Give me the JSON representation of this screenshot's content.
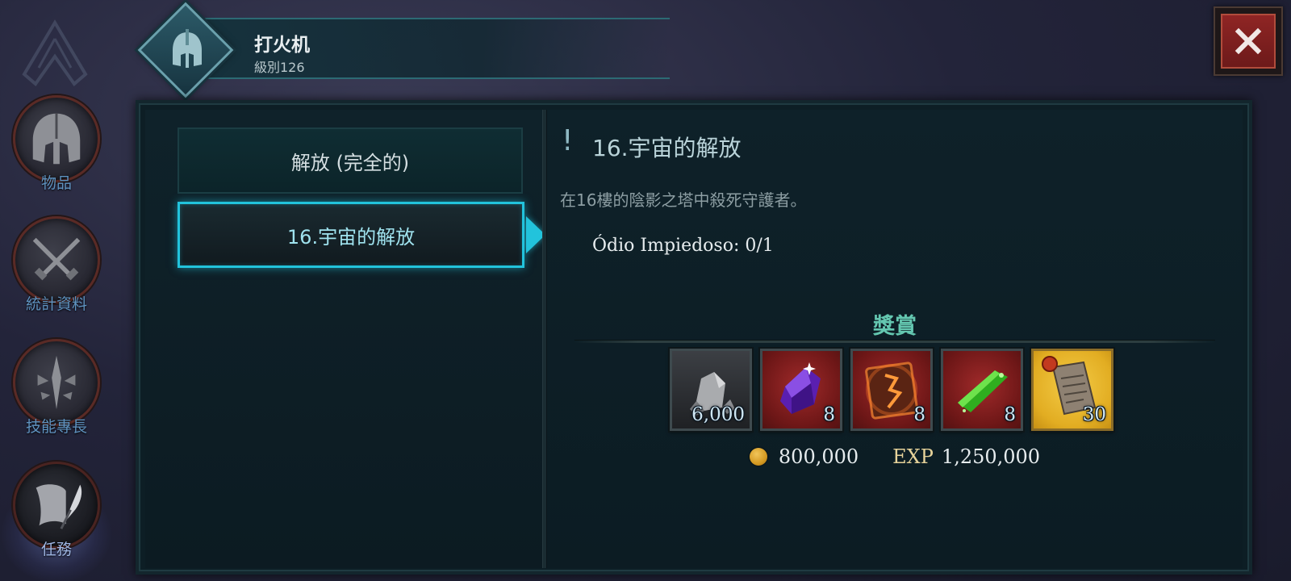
{
  "header": {
    "name": "打火机",
    "level": "級別126"
  },
  "sidebar": {
    "items": [
      {
        "label": "物品",
        "icon": "helmet-icon"
      },
      {
        "label": "統計資料",
        "icon": "crossed-swords-icon"
      },
      {
        "label": "技能專長",
        "icon": "skill-sword-icon"
      },
      {
        "label": "任務",
        "icon": "quest-quill-icon",
        "active": true
      }
    ]
  },
  "quests": {
    "category_label": "解放 (完全的)",
    "selected_label": "16.宇宙的解放"
  },
  "detail": {
    "exclaim": "!",
    "title": "16.宇宙的解放",
    "description": "在16樓的陰影之塔中殺死守護者。",
    "objective": "Ódio Impiedoso: 0/1",
    "rewards_title": "獎賞",
    "rewards": [
      {
        "item": "stone-ore-icon",
        "qty": "6,000"
      },
      {
        "item": "purple-gem-icon",
        "qty": "8"
      },
      {
        "item": "rune-tome-icon",
        "qty": "8"
      },
      {
        "item": "green-crystal-icon",
        "qty": "8"
      },
      {
        "item": "scroll-icon",
        "qty": "30"
      }
    ],
    "gold": "800,000",
    "exp_label": "EXP",
    "exp": "1,250,000"
  },
  "colors": {
    "accent": "#22c3dc",
    "rewards_title": "#64c7b0",
    "close_button": "#8f2524"
  }
}
